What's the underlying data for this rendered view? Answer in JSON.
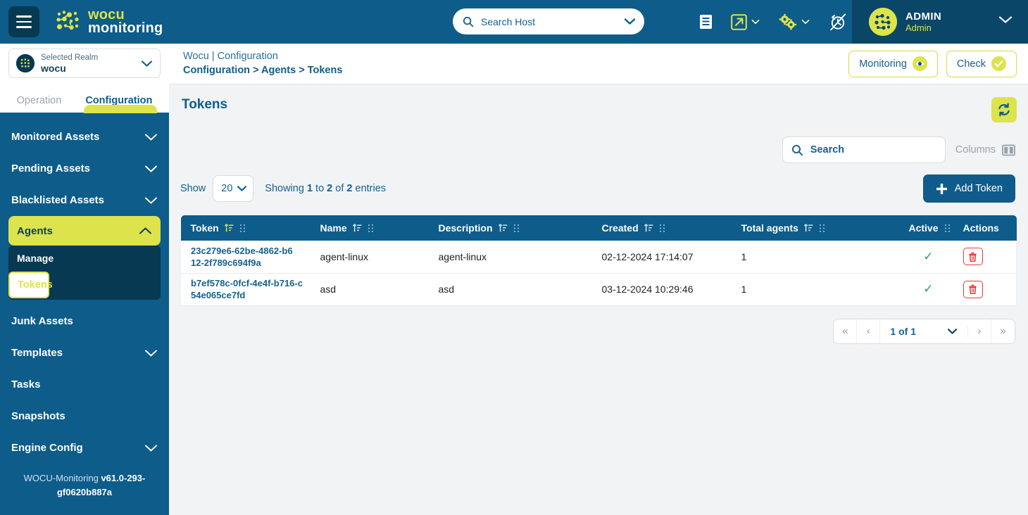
{
  "header": {
    "menu_icon": "hamburger-icon",
    "logo_line1": "wocu",
    "logo_line2": "monitoring",
    "search": {
      "placeholder": "Search Host",
      "value": "",
      "icon": "search-icon",
      "chevron": "chevron-down-icon"
    },
    "icons": [
      {
        "name": "docs-icon",
        "label": ""
      },
      {
        "name": "external-link-icon",
        "label": ""
      },
      {
        "name": "gears-icon",
        "label": ""
      },
      {
        "name": "autorefresh-off-icon",
        "label": ""
      }
    ],
    "user": {
      "name": "ADMIN",
      "role": "Admin",
      "avatar": "user-avatar",
      "chevron": "chevron-down-icon"
    }
  },
  "sidebar": {
    "realm": {
      "label": "Selected Realm",
      "value": "wocu",
      "icon": "realm-icon",
      "chevron": "chevron-down-icon"
    },
    "tabs": [
      {
        "label": "Operation",
        "active": false
      },
      {
        "label": "Configuration",
        "active": true
      }
    ],
    "items": [
      {
        "label": "Monitored Assets",
        "expandable": true,
        "active": false
      },
      {
        "label": "Pending Assets",
        "expandable": true,
        "active": false
      },
      {
        "label": "Blacklisted Assets",
        "expandable": true,
        "active": false
      },
      {
        "label": "Agents",
        "expandable": true,
        "active": true,
        "expanded": true
      },
      {
        "label": "Junk Assets",
        "expandable": false,
        "active": false
      },
      {
        "label": "Templates",
        "expandable": true,
        "active": false
      },
      {
        "label": "Tasks",
        "expandable": false,
        "active": false
      },
      {
        "label": "Snapshots",
        "expandable": false,
        "active": false
      },
      {
        "label": "Engine Config",
        "expandable": true,
        "active": false
      }
    ],
    "submenu": [
      {
        "label": "Manage",
        "selected": false
      },
      {
        "label": "Tokens",
        "selected": true
      }
    ],
    "footer_prefix": "WOCU-Monitoring ",
    "footer_version": "v61.0-293-gf0620b887a"
  },
  "breadcrumb": {
    "line1": "Wocu | Configuration",
    "line2": "Configuration > Agents > Tokens",
    "monitoring_button": "Monitoring",
    "check_button": "Check"
  },
  "page": {
    "title": "Tokens",
    "refresh_icon": "refresh-icon",
    "search": {
      "placeholder": "Search",
      "value": "",
      "icon": "search-icon"
    },
    "columns_label": "Columns",
    "columns_icon": "columns-icon",
    "show_label": "Show",
    "show_value": "20",
    "showing_text_parts": {
      "a": "Showing ",
      "b": "1",
      "c": " to ",
      "d": "2",
      "e": " of ",
      "f": "2",
      "g": " entries"
    },
    "add_button": "Add Token",
    "add_icon": "plus-icon"
  },
  "table": {
    "columns": [
      {
        "label": "Token",
        "sortable": true,
        "sort_active": true,
        "drag": true
      },
      {
        "label": "Name",
        "sortable": true,
        "sort_active": false,
        "drag": true
      },
      {
        "label": "Description",
        "sortable": true,
        "sort_active": false,
        "drag": true
      },
      {
        "label": "Created",
        "sortable": true,
        "sort_active": false,
        "drag": true
      },
      {
        "label": "Total agents",
        "sortable": true,
        "sort_active": false,
        "drag": true
      },
      {
        "label": "Active",
        "sortable": false,
        "sort_active": false,
        "drag": true
      },
      {
        "label": "Actions",
        "sortable": false,
        "sort_active": false,
        "drag": false
      }
    ],
    "rows": [
      {
        "token": "23c279e6-62be-4862-b612-2f789c694f9a",
        "name": "agent-linux",
        "description": "agent-linux",
        "created": "02-12-2024 17:14:07",
        "total_agents": "1",
        "active": "✓",
        "action_icon": "trash-icon"
      },
      {
        "token": "b7ef578c-0fcf-4e4f-b716-c54e065ce7fd",
        "name": "asd",
        "description": "asd",
        "created": "03-12-2024 10:29:46",
        "total_agents": "1",
        "active": "✓",
        "action_icon": "trash-icon"
      }
    ]
  },
  "pagination": {
    "first": "«",
    "prev": "‹",
    "current": "1 of 1",
    "next": "›",
    "last": "»",
    "chevron": "chevron-down-icon"
  },
  "colors": {
    "brand_blue": "#0d5c8a",
    "accent_lime": "#dde34a",
    "navy_deep": "#073953",
    "success_green": "#23a455",
    "danger_red": "#e23a3a"
  }
}
